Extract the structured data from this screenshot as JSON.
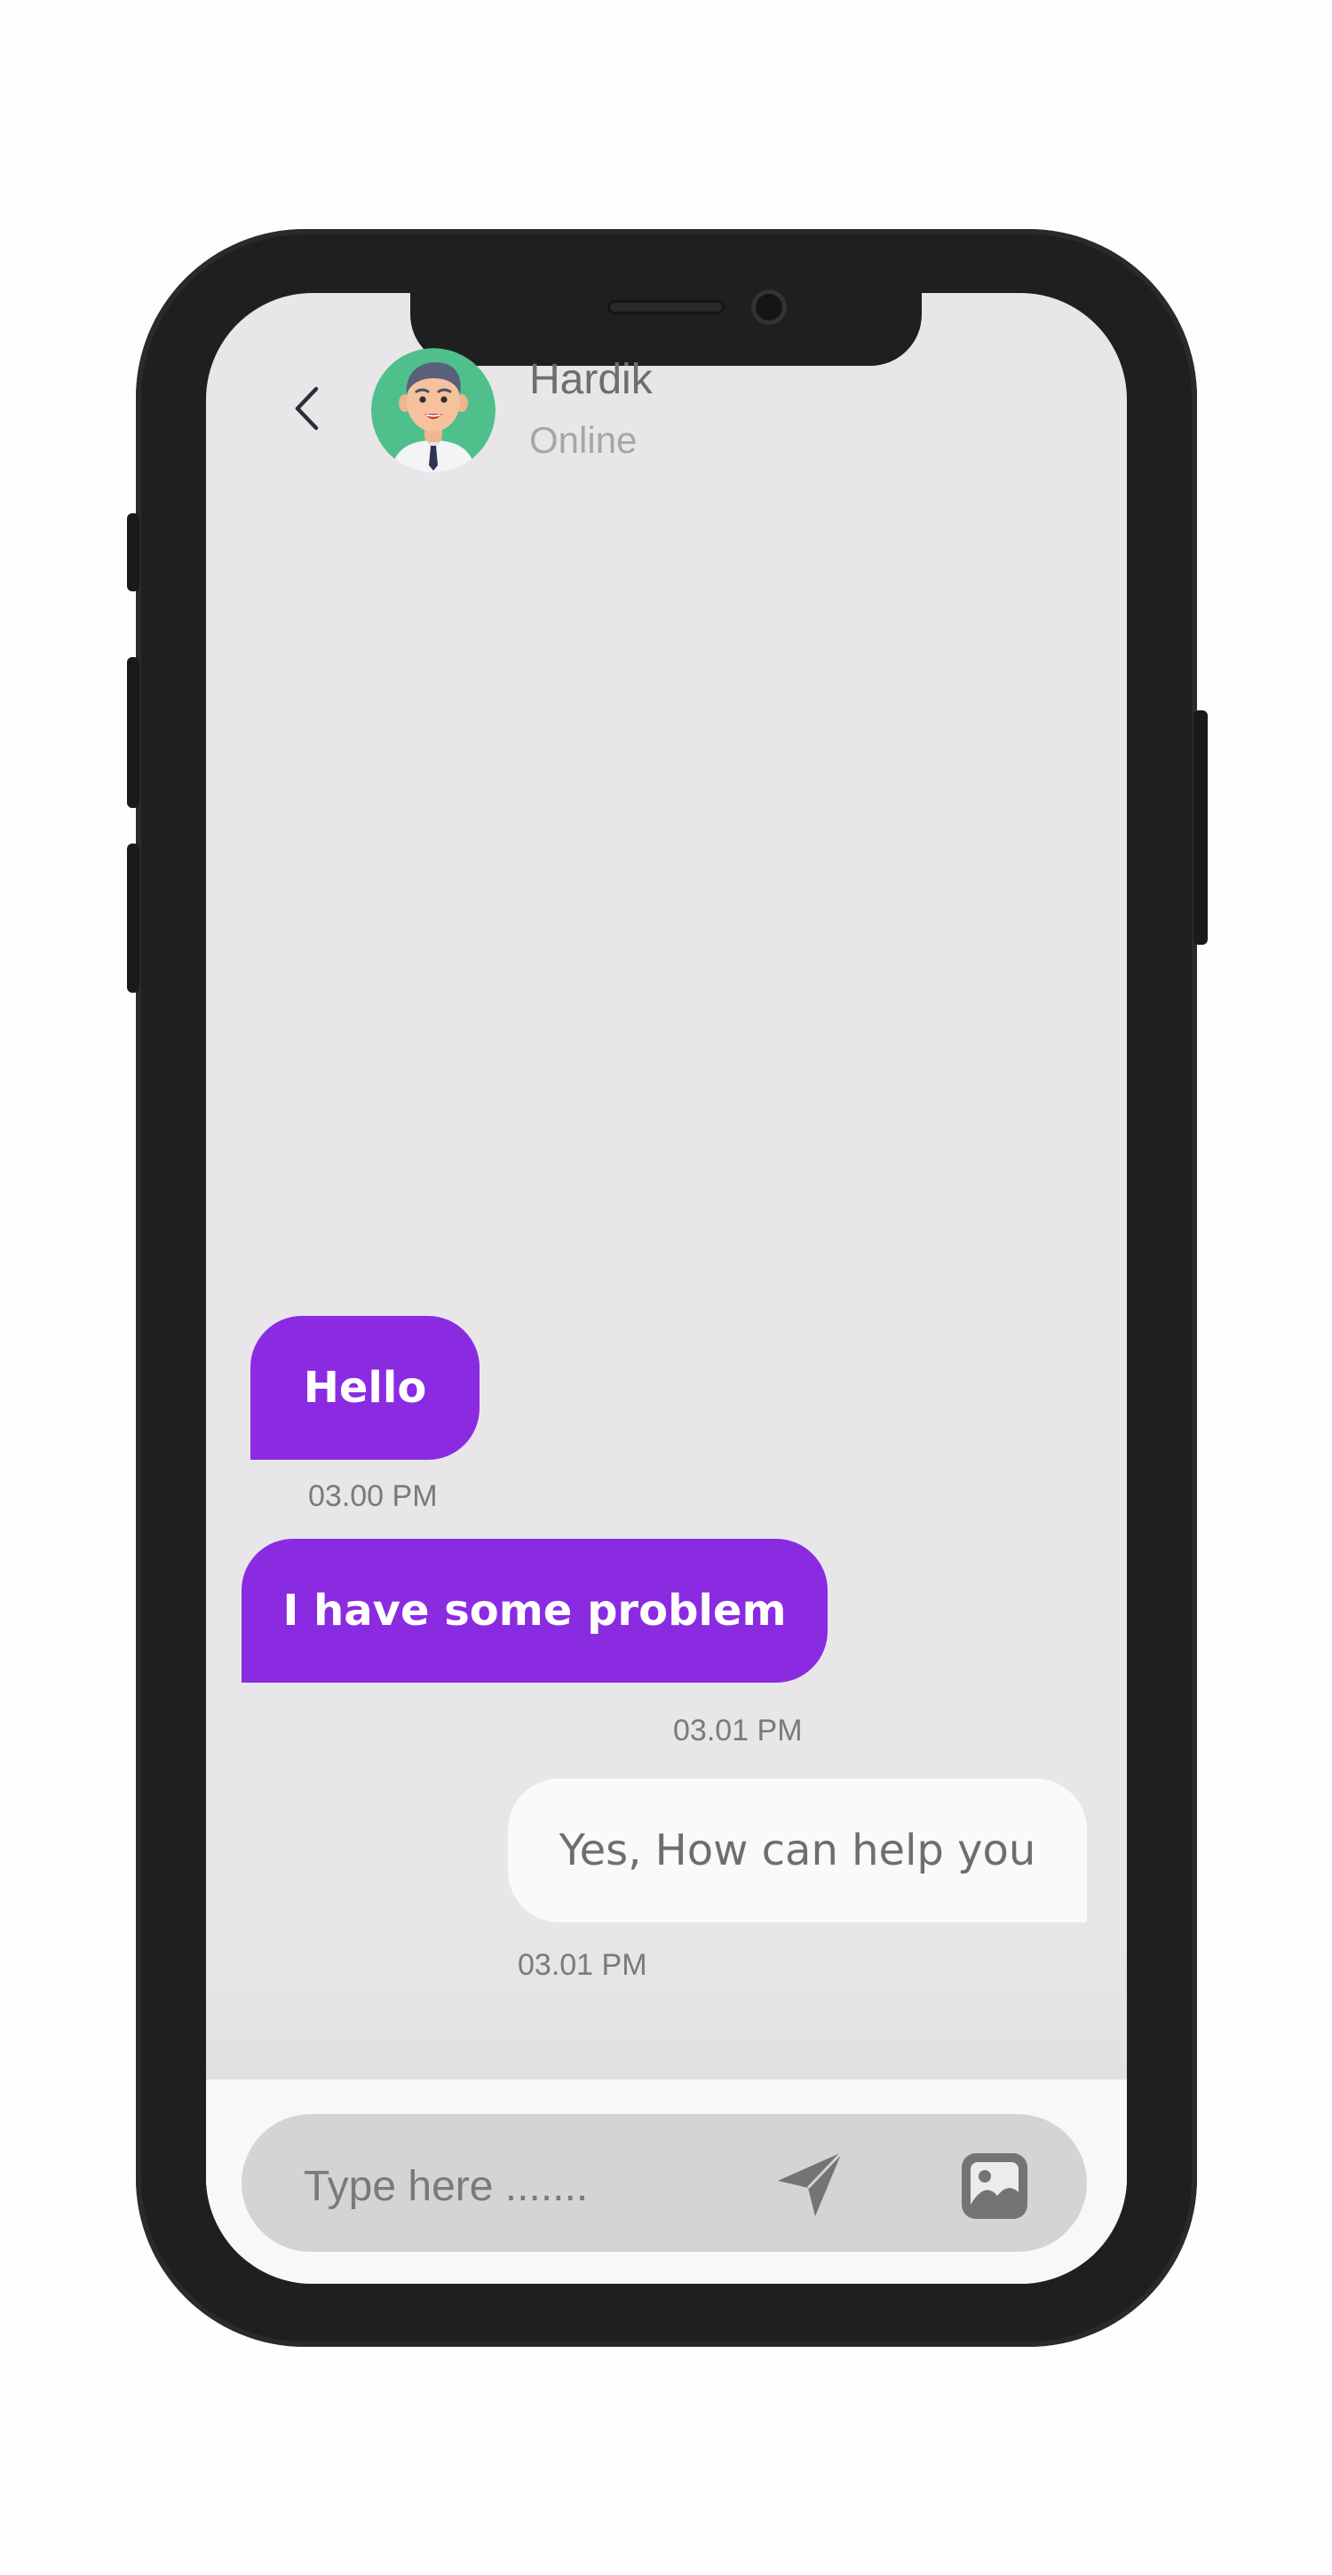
{
  "header": {
    "back_icon": "chevron-left-icon",
    "contact_name": "Hardik",
    "contact_status": "Online",
    "avatar_icon": "avatar-man-icon"
  },
  "messages": [
    {
      "text": "Hello",
      "time": "03.00 PM",
      "direction": "incoming"
    },
    {
      "text": "I have some problem",
      "time": "03.01 PM",
      "direction": "incoming"
    },
    {
      "text": "Yes, How can help you",
      "time": "03.01 PM",
      "direction": "outgoing"
    }
  ],
  "composer": {
    "placeholder": "Type here .......",
    "send_icon": "send-icon",
    "image_icon": "image-icon"
  },
  "colors": {
    "accent": "#8a2be2",
    "screen_bg": "#e8e6e8",
    "phone_body": "#1f1f1f",
    "input_bg": "#d4d4d4"
  }
}
